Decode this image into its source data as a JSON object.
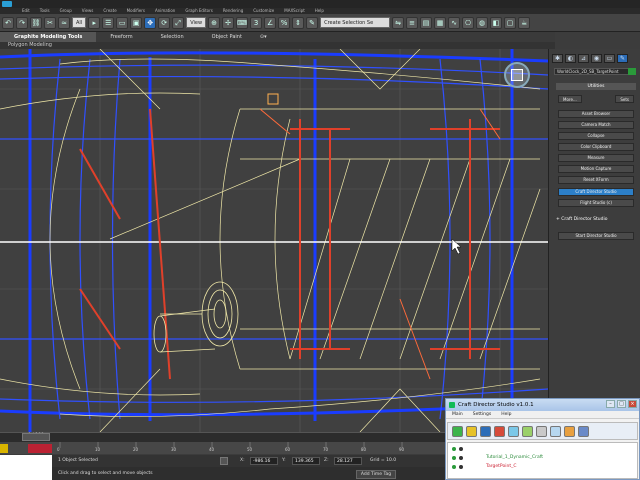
{
  "app": {
    "menus": [
      "Edit",
      "Tools",
      "Group",
      "Views",
      "Create",
      "Modifiers",
      "Animation",
      "Graph Editors",
      "Rendering",
      "Customize",
      "MAXScript",
      "Help"
    ],
    "toolbar_dropdown_1": "All",
    "toolbar_dropdown_2": "View",
    "toolbar_dropdown_3": "Create Selection Se"
  },
  "ribbon": {
    "tabs": [
      "Graphite Modeling Tools",
      "Freeform",
      "Selection",
      "Object Paint"
    ],
    "active_tab": "Graphite Modeling Tools",
    "sub_label": "Polygon Modeling"
  },
  "command_panel": {
    "object_name": "WorldClock_2D_SB_TargetPoint",
    "rollout_title": "Utilities",
    "more_label": "More...",
    "sets_label": "Sets",
    "buttons": [
      "Asset Browser",
      "Camera Match",
      "Collapse",
      "Color Clipboard",
      "Measure",
      "Motion Capture",
      "Reset XForm",
      "Craft Director Studio",
      "Flight Studio (c)"
    ],
    "selected_button": "Craft Director Studio",
    "section_title": "Craft Director Studio",
    "start_button": "Start Director Studio"
  },
  "timeline": {
    "frame_label": "0 / 100",
    "ticks": [
      "0",
      "10",
      "20",
      "30",
      "40",
      "50",
      "60",
      "70",
      "80",
      "90"
    ]
  },
  "status": {
    "selection": "1 Object Selected",
    "prompt": "Click and drag to select and move objects",
    "x_label": "X:",
    "x_value": "-986.16",
    "y_label": "Y:",
    "y_value": "139.365",
    "z_label": "Z:",
    "z_value": "28.127",
    "grid": "Grid = 10.0",
    "add_time_tag": "Add Time Tag"
  },
  "craft_window": {
    "title": "Craft Director Studio v1.0.1",
    "menu": [
      "Main",
      "Settings",
      "Help"
    ],
    "tree": [
      {
        "name": "Tutorial_1_Dynamic_Craft",
        "color": "green"
      },
      {
        "name": "TargetPoint_C",
        "color": "red"
      }
    ]
  },
  "colors": {
    "viewport_bg": "#404040",
    "wire_blue": "#1a3cff",
    "wire_red": "#e0402a",
    "wire_yellow": "#f0e8a8",
    "selected_button": "#2c7fc8"
  }
}
